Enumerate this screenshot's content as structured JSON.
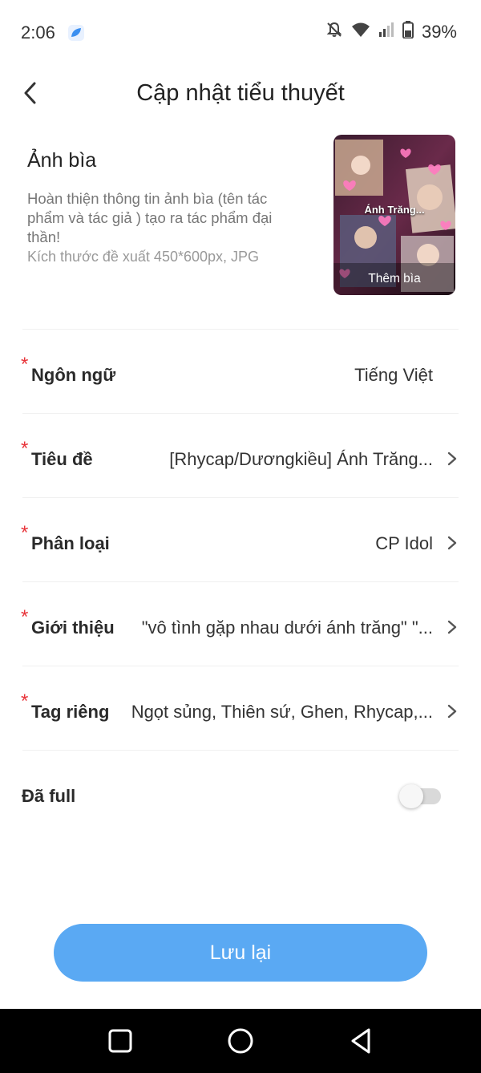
{
  "status_bar": {
    "time": "2:06",
    "battery": "39%",
    "icons": [
      "app-notification-icon",
      "bell-off-icon",
      "wifi-icon",
      "signal-icon",
      "battery-icon"
    ]
  },
  "header": {
    "title": "Cập nhật tiểu thuyết",
    "back_icon": "chevron-left-icon"
  },
  "cover": {
    "heading": "Ảnh bìa",
    "description": "Hoàn thiện thông tin ảnh bìa (tên tác phẩm và tác giả ) tạo ra tác phẩm đại thần!",
    "size_hint": "Kích thước đề xuất 450*600px, JPG",
    "image_title": "Ánh Trăng...",
    "add_label": "Thêm bìa"
  },
  "form": {
    "rows": [
      {
        "label": "Ngôn ngữ",
        "value": "Tiếng Việt",
        "required": "*",
        "has_chevron": false
      },
      {
        "label": "Tiêu đề",
        "value": "[Rhycap/Dươngkiều] Ánh Trăng...",
        "required": "*",
        "has_chevron": true
      },
      {
        "label": "Phân loại",
        "value": "CP Idol",
        "required": "*",
        "has_chevron": true
      },
      {
        "label": "Giới thiệu",
        "value": "\"vô tình gặp nhau dưới ánh trăng\" \"...",
        "required": "*",
        "has_chevron": true
      },
      {
        "label": "Tag riêng",
        "value": "Ngọt sủng, Thiên sứ, Ghen, Rhycap,...",
        "required": "*",
        "has_chevron": true
      }
    ],
    "completed": {
      "label": "Đã full",
      "on": false
    }
  },
  "save_button": {
    "label": "Lưu lại"
  },
  "colors": {
    "accent": "#5aa9f3",
    "required": "#e8343a",
    "text": "#2a2a2a",
    "muted": "#777777"
  }
}
